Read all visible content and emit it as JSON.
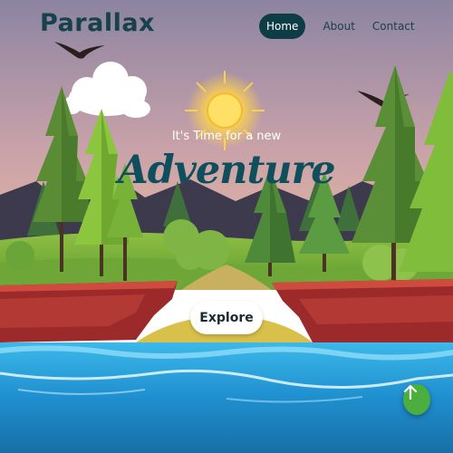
{
  "brand": {
    "name": "Parallax"
  },
  "nav": {
    "items": [
      "Home",
      "About",
      "Contact"
    ],
    "active": "Home"
  },
  "hero": {
    "tagline": "It's Time for a new",
    "headline": "Adventure",
    "cta_label": "Explore"
  },
  "colors": {
    "brand_dark": "#0f3d47",
    "headline": "#0f4f5c",
    "scroll_button": "#4caf3d",
    "water": "#1e9bd6",
    "sky_top": "#8c84a2",
    "sky_bottom": "#e8b5a0"
  },
  "icons": {
    "scroll_top": "arrow-up-icon",
    "sun": "sun-icon",
    "cloud": "cloud-icon",
    "bird": "bird-icon"
  }
}
